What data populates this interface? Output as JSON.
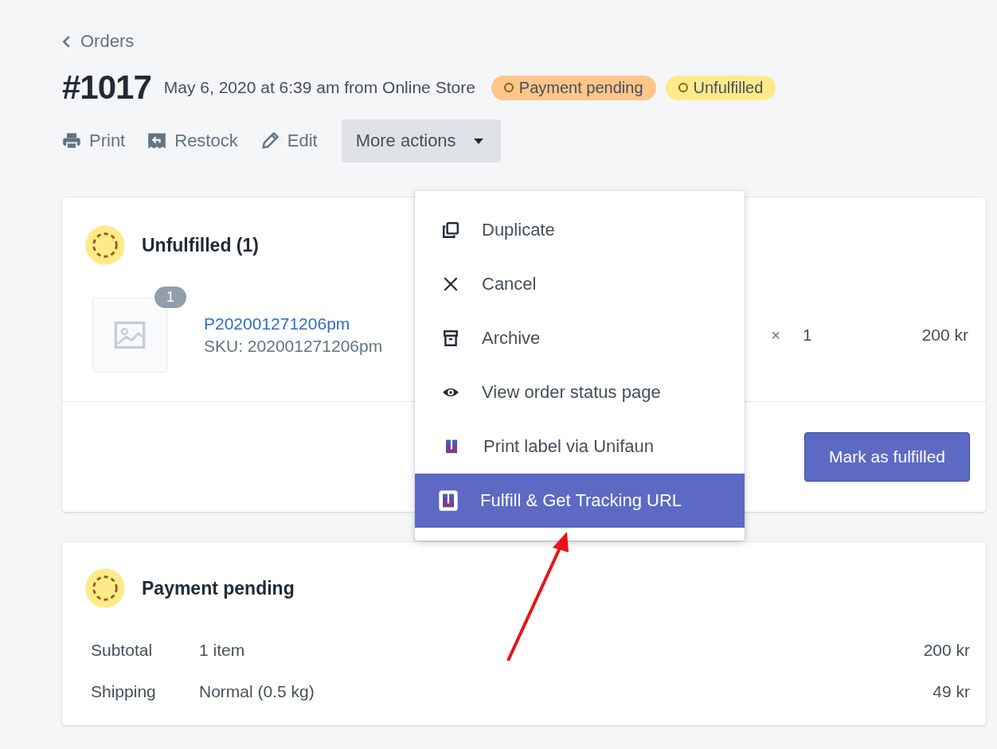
{
  "breadcrumb": {
    "label": "Orders"
  },
  "header": {
    "title": "#1017",
    "subtitle": "May 6, 2020 at 6:39 am from Online Store",
    "badges": [
      {
        "label": "Payment pending",
        "color": "#ffc58b"
      },
      {
        "label": "Unfulfilled",
        "color": "#ffea8a"
      }
    ]
  },
  "actions": [
    {
      "label": "Print"
    },
    {
      "label": "Restock"
    },
    {
      "label": "Edit"
    }
  ],
  "more_actions": {
    "label": "More actions",
    "expanded": true
  },
  "menu": [
    {
      "label": "Duplicate",
      "selected": false
    },
    {
      "label": "Cancel",
      "selected": false
    },
    {
      "label": "Archive",
      "selected": false
    },
    {
      "label": "View order status page",
      "selected": false
    },
    {
      "label": "Print label via Unifaun",
      "selected": false
    },
    {
      "label": "Fulfill & Get Tracking URL",
      "selected": true
    }
  ],
  "fulfillment": {
    "title": "Unfulfilled (1)",
    "item": {
      "quantity_badge": "1",
      "name": "P202001271206pm",
      "sku": "SKU: 202001271206pm",
      "times": "×",
      "quantity": "1",
      "total": "200 kr"
    },
    "button": "Mark as fulfilled"
  },
  "payment": {
    "title": "Payment pending",
    "rows": [
      {
        "label": "Subtotal",
        "detail": "1 item",
        "amount": "200 kr"
      },
      {
        "label": "Shipping",
        "detail": "Normal (0.5 kg)",
        "amount": "49 kr"
      }
    ]
  }
}
